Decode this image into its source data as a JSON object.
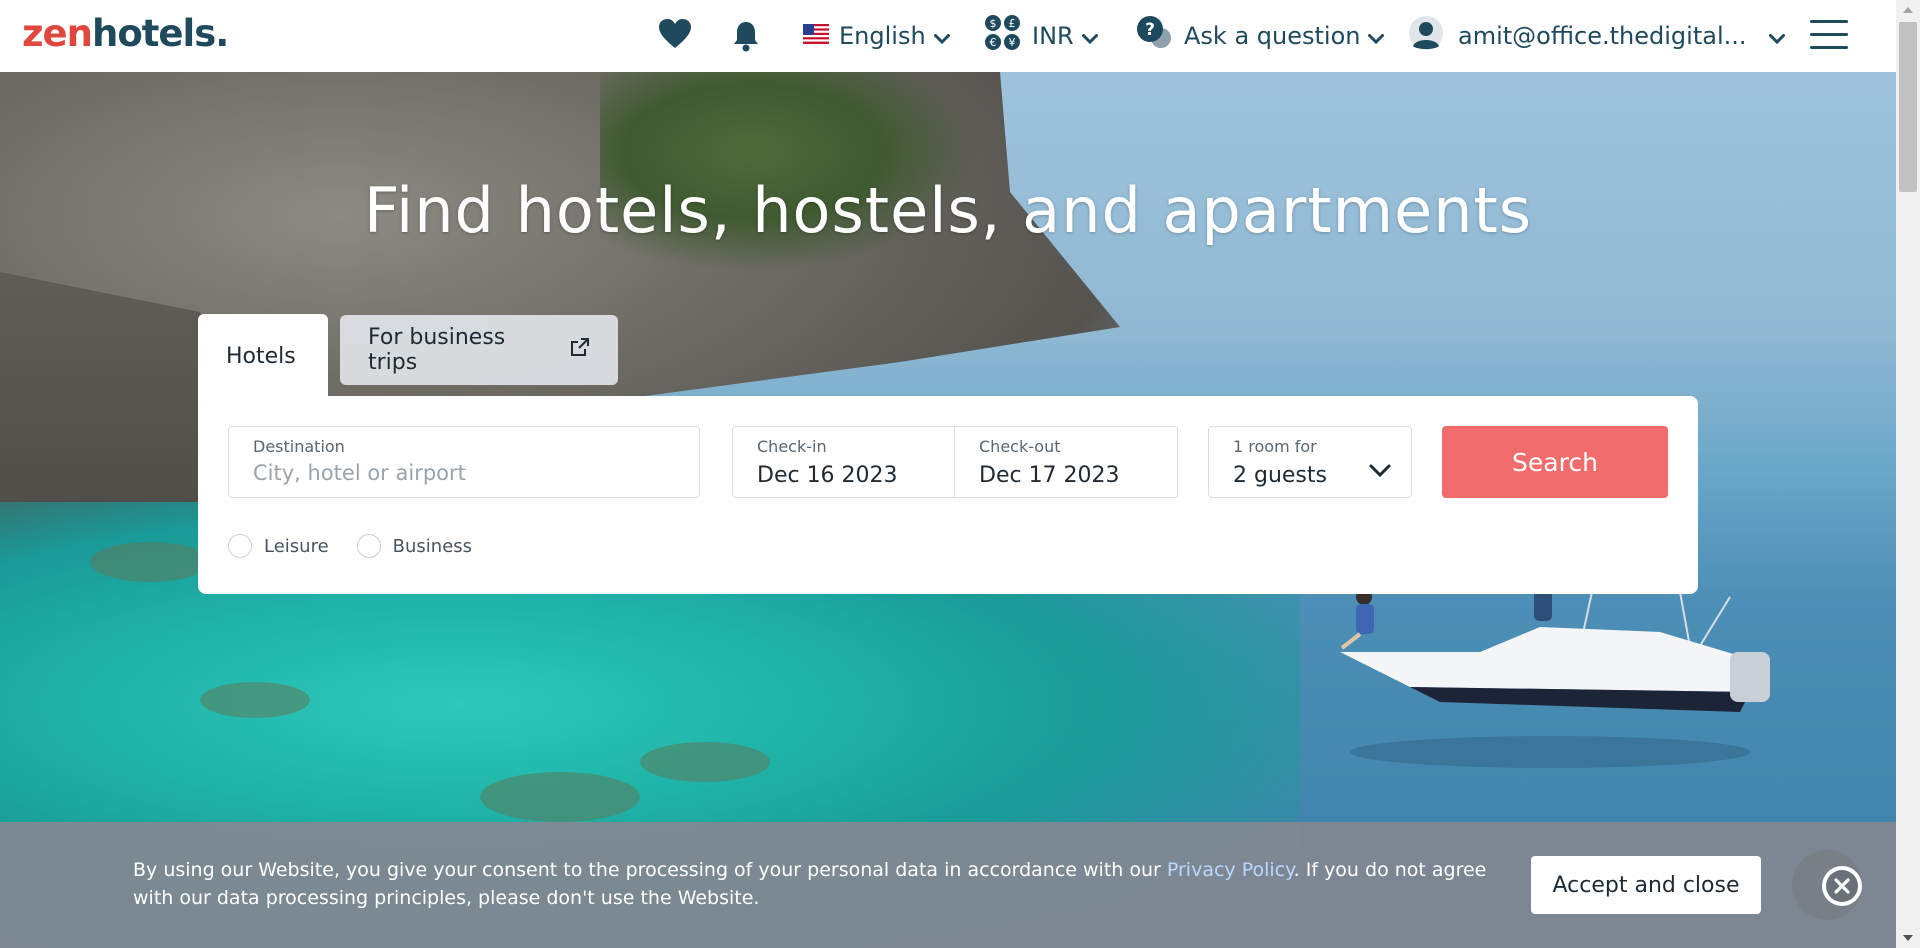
{
  "header": {
    "logo_zen": "zen",
    "logo_hotels": "hotels",
    "logo_dot": ".",
    "language": "English",
    "currency": "INR",
    "help": "Ask a question",
    "account": "amit@office.thedigital...",
    "icons": {
      "favorites": "heart-icon",
      "notifications": "bell-icon",
      "language": "us-flag-icon",
      "currency": "currency-icon",
      "help": "question-chat-icon",
      "account": "user-avatar-icon",
      "menu": "hamburger-menu-icon"
    }
  },
  "hero": {
    "title": "Find hotels, hostels, and apartments"
  },
  "tabs": [
    {
      "label": "Hotels",
      "active": true
    },
    {
      "label": "For business trips",
      "active": false,
      "icon": "external-link-icon"
    }
  ],
  "search": {
    "destination_label": "Destination",
    "destination_placeholder": "City, hotel or airport",
    "checkin_label": "Check-in",
    "checkin_value": "Dec 16 2023",
    "checkout_label": "Check-out",
    "checkout_value": "Dec 17 2023",
    "guests_label": "1 room for",
    "guests_value": "2 guests",
    "search_button": "Search",
    "trip_types": [
      "Leisure",
      "Business"
    ]
  },
  "cookie": {
    "text_before": "By using our Website, you give your consent to the processing of your personal data in accordance with our ",
    "link": "Privacy Policy",
    "text_after": ". If you do not agree with our data processing principles, please don't use the Website.",
    "accept_button": "Accept and close"
  },
  "colors": {
    "brand_red": "#e0483f",
    "brand_dark": "#1f4a5e",
    "search_button": "#f16d6b",
    "cookie_bar": "#82888f",
    "link": "#b9d8ff"
  }
}
